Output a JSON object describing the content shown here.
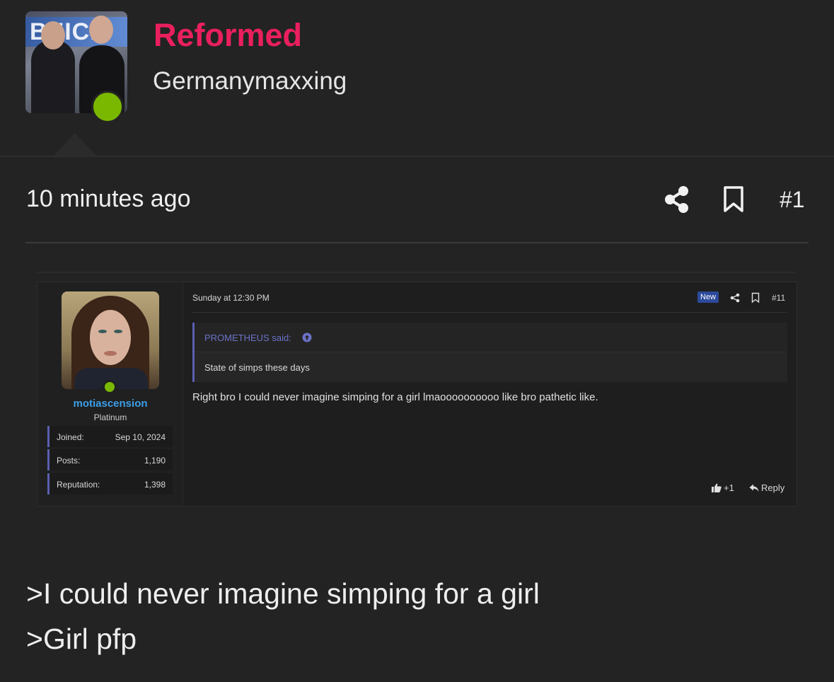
{
  "profile": {
    "username": "Reformed",
    "user_title": "Germanymaxxing",
    "avatar_banner_text": "BEICH",
    "status": "online",
    "username_color": "#ea1f5e",
    "online_color": "#7ab800"
  },
  "post_meta": {
    "timestamp": "10 minutes ago",
    "share_icon": "share-icon",
    "bookmark_icon": "bookmark-icon",
    "post_number": "#1"
  },
  "embedded_post": {
    "author": {
      "username": "motiascension",
      "rank": "Platinum",
      "status": "online",
      "stats": [
        {
          "label": "Joined:",
          "value": "Sep 10, 2024"
        },
        {
          "label": "Posts:",
          "value": "1,190"
        },
        {
          "label": "Reputation:",
          "value": "1,398"
        }
      ]
    },
    "date": "Sunday at 12:30 PM",
    "new_badge": "New",
    "post_number": "#11",
    "quote": {
      "author_line": "PROMETHEUS said:",
      "text": "State of simps these days"
    },
    "body": "Right bro I could never imagine simping for a girl lmaoooooooooo like bro pathetic like.",
    "reactions": "+1",
    "reply_label": "Reply",
    "accent_color": "#5a5fb0",
    "username_color": "#3b9fe8"
  },
  "post_body": {
    "line1": ">I could never imagine simping for a girl",
    "line2": ">Girl pfp"
  }
}
